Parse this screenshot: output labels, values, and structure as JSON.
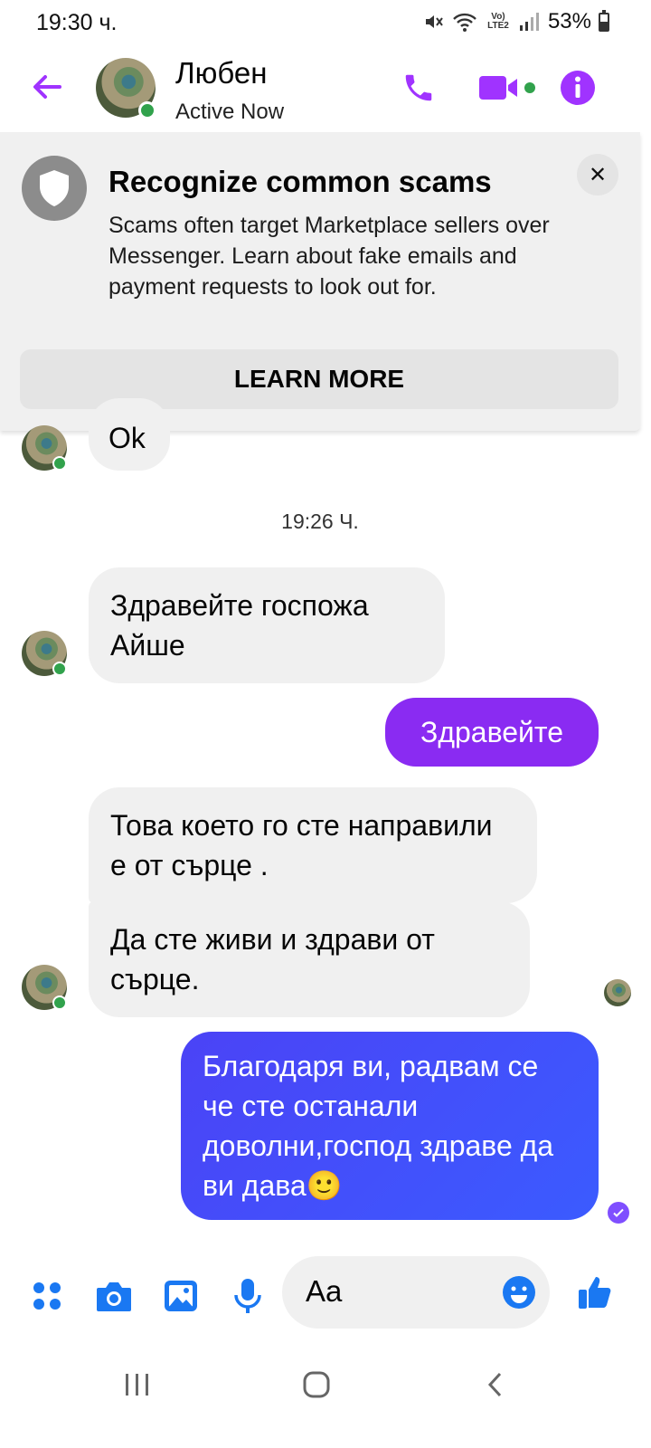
{
  "status_bar": {
    "time": "19:30 ч.",
    "battery": "53%",
    "network": "Vo) LTE2"
  },
  "header": {
    "contact_name": "Любен",
    "status": "Active Now"
  },
  "banner": {
    "title": "Recognize common scams",
    "text": "Scams often target Marketplace sellers over Messenger. Learn about fake emails and payment requests to look out for.",
    "button_label": "LEARN MORE",
    "close_label": "✕"
  },
  "messages": [
    {
      "from": "contact",
      "text": "Ok"
    },
    {
      "from": "contact",
      "text": "Здравейте госпожа Айше"
    },
    {
      "from": "me",
      "text": "Здравейте"
    },
    {
      "from": "contact",
      "text": "Това което го сте направили  е от сърце ."
    },
    {
      "from": "contact",
      "text": "Да сте живи и здрави от сърце."
    },
    {
      "from": "me",
      "text": "Благодаря ви, радвам се че сте останали доволни,господ здраве да ви дава🙂"
    }
  ],
  "timestamp": "19:26 Ч.",
  "composer": {
    "placeholder": "Aa"
  },
  "colors": {
    "accent": "#a033ff",
    "online": "#31a24c",
    "bubble_in": "#f0f0f0",
    "bubble_out_purple": "#8a2bf2",
    "bubble_out_blue": "#3b5bff",
    "composer_icons": "#1a78f2"
  },
  "icons": {
    "back": "arrow-left-icon",
    "call": "phone-icon",
    "video": "video-camera-icon",
    "info": "info-icon",
    "shield": "shield-icon",
    "menu": "grid-dots-icon",
    "camera": "camera-icon",
    "gallery": "image-icon",
    "mic": "microphone-icon",
    "emoji": "smiley-icon",
    "like": "thumbs-up-icon"
  }
}
